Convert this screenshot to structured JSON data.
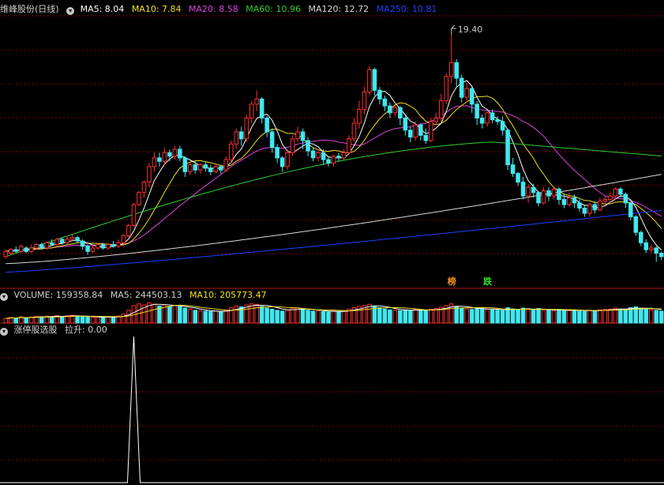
{
  "header": {
    "title": "维峰股份(日线)",
    "ma": [
      {
        "label": "MA5: 8.04",
        "color": "#ffffff"
      },
      {
        "label": "MA10: 7.84",
        "color": "#f0e020"
      },
      {
        "label": "MA20: 8.58",
        "color": "#e040e0"
      },
      {
        "label": "MA60: 10.96",
        "color": "#30d030"
      },
      {
        "label": "MA120: 12.72",
        "color": "#d8d8d8"
      },
      {
        "label": "MA250: 10.81",
        "color": "#2040ff"
      }
    ]
  },
  "volume_header": {
    "volume_label": "VOLUME: 159358.84",
    "ma5_label": "MA5: 244503.13",
    "ma10_label": "MA10: 205773.47"
  },
  "indicator_header": {
    "name": "涨停股选股",
    "value_label": "拉升: 0.00"
  },
  "annotations": {
    "peak_price": "19.40",
    "tag1": "榜",
    "tag2": "跌"
  },
  "colors": {
    "up": "#ff3030",
    "down": "#40e8f0",
    "grid": "#8b0000",
    "ma5": "#ffffff",
    "ma10": "#f0e020",
    "ma20": "#e040e0",
    "ma60": "#30d030",
    "ma120": "#d8d8d8",
    "ma250": "#2040ff"
  },
  "chart_data": {
    "type": "candlestick",
    "price_range": [
      5.0,
      20.5
    ],
    "candles": [
      [
        6.6,
        6.9,
        6.5,
        7.0
      ],
      [
        6.8,
        7.0,
        6.7,
        7.1
      ],
      [
        7.0,
        6.9,
        6.8,
        7.2
      ],
      [
        6.9,
        7.2,
        6.8,
        7.3
      ],
      [
        7.1,
        6.9,
        6.8,
        7.2
      ],
      [
        6.9,
        7.1,
        6.8,
        7.3
      ],
      [
        7.1,
        7.3,
        7.0,
        7.4
      ],
      [
        7.3,
        7.1,
        7.0,
        7.4
      ],
      [
        7.1,
        7.4,
        7.0,
        7.5
      ],
      [
        7.4,
        7.3,
        7.2,
        7.6
      ],
      [
        7.3,
        7.6,
        7.2,
        7.7
      ],
      [
        7.6,
        7.4,
        7.3,
        7.7
      ],
      [
        7.4,
        7.6,
        7.3,
        7.8
      ],
      [
        7.6,
        7.7,
        7.5,
        7.9
      ],
      [
        7.7,
        7.5,
        7.4,
        7.8
      ],
      [
        7.5,
        7.2,
        7.0,
        7.6
      ],
      [
        7.2,
        6.9,
        6.7,
        7.3
      ],
      [
        6.9,
        7.1,
        6.8,
        7.3
      ],
      [
        7.1,
        7.3,
        7.0,
        7.4
      ],
      [
        7.3,
        7.1,
        7.0,
        7.4
      ],
      [
        7.1,
        7.3,
        7.0,
        7.4
      ],
      [
        7.3,
        7.2,
        7.1,
        7.5
      ],
      [
        7.2,
        7.4,
        7.1,
        7.6
      ],
      [
        7.4,
        7.8,
        7.3,
        7.9
      ],
      [
        7.8,
        8.4,
        7.7,
        8.5
      ],
      [
        8.4,
        9.6,
        8.3,
        9.7
      ],
      [
        9.6,
        10.3,
        9.5,
        10.4
      ],
      [
        10.3,
        10.9,
        10.0,
        11.0
      ],
      [
        10.9,
        11.8,
        10.6,
        12.0
      ],
      [
        11.8,
        12.3,
        11.5,
        12.6
      ],
      [
        12.3,
        12.1,
        11.8,
        12.6
      ],
      [
        12.1,
        12.6,
        11.9,
        12.9
      ],
      [
        12.6,
        12.4,
        12.1,
        12.8
      ],
      [
        12.4,
        12.8,
        12.2,
        13.0
      ],
      [
        12.8,
        12.3,
        12.1,
        13.0
      ],
      [
        12.3,
        11.5,
        11.2,
        12.4
      ],
      [
        11.5,
        11.9,
        11.3,
        12.1
      ],
      [
        11.9,
        11.6,
        11.4,
        12.1
      ],
      [
        11.6,
        11.9,
        11.4,
        12.0
      ],
      [
        11.9,
        11.7,
        11.5,
        12.1
      ],
      [
        11.7,
        11.5,
        11.3,
        11.9
      ],
      [
        11.5,
        11.8,
        11.4,
        12.0
      ],
      [
        11.8,
        11.6,
        11.4,
        11.9
      ],
      [
        11.6,
        12.2,
        11.5,
        12.4
      ],
      [
        12.2,
        13.1,
        12.0,
        13.3
      ],
      [
        13.1,
        13.8,
        12.8,
        14.0
      ],
      [
        13.8,
        13.4,
        13.0,
        14.1
      ],
      [
        13.4,
        14.6,
        13.2,
        14.8
      ],
      [
        14.6,
        15.4,
        14.3,
        15.6
      ],
      [
        15.4,
        15.7,
        15.0,
        16.2
      ],
      [
        15.7,
        14.6,
        14.3,
        15.8
      ],
      [
        14.6,
        13.8,
        13.5,
        14.7
      ],
      [
        13.8,
        12.9,
        12.6,
        14.0
      ],
      [
        12.9,
        12.3,
        12.0,
        13.1
      ],
      [
        12.3,
        11.8,
        11.5,
        12.4
      ],
      [
        11.8,
        12.6,
        11.6,
        12.8
      ],
      [
        12.6,
        13.4,
        12.4,
        13.6
      ],
      [
        13.4,
        13.8,
        13.2,
        14.1
      ],
      [
        13.8,
        13.3,
        12.8,
        14.0
      ],
      [
        13.3,
        12.7,
        12.4,
        13.5
      ],
      [
        12.7,
        12.3,
        12.1,
        12.9
      ],
      [
        12.3,
        12.6,
        12.1,
        12.8
      ],
      [
        12.6,
        12.2,
        11.9,
        12.8
      ],
      [
        12.2,
        12.0,
        11.8,
        12.4
      ],
      [
        12.0,
        12.4,
        11.8,
        12.5
      ],
      [
        12.4,
        12.3,
        12.1,
        12.6
      ],
      [
        12.3,
        12.6,
        12.2,
        12.8
      ],
      [
        12.6,
        13.4,
        12.5,
        13.6
      ],
      [
        13.4,
        14.3,
        13.2,
        14.6
      ],
      [
        14.3,
        15.1,
        14.0,
        15.6
      ],
      [
        15.1,
        16.1,
        14.8,
        16.4
      ],
      [
        16.1,
        17.4,
        15.9,
        17.6
      ],
      [
        17.4,
        16.2,
        15.9,
        17.5
      ],
      [
        16.2,
        15.7,
        15.4,
        16.4
      ],
      [
        15.7,
        15.3,
        15.0,
        15.9
      ],
      [
        15.3,
        14.9,
        14.6,
        15.5
      ],
      [
        14.9,
        15.2,
        14.7,
        15.4
      ],
      [
        15.2,
        14.6,
        14.2,
        15.3
      ],
      [
        14.6,
        13.9,
        13.6,
        14.8
      ],
      [
        13.9,
        13.5,
        13.2,
        14.1
      ],
      [
        13.5,
        14.2,
        13.3,
        14.4
      ],
      [
        14.2,
        13.6,
        13.3,
        14.3
      ],
      [
        13.6,
        13.3,
        13.1,
        14.0
      ],
      [
        13.3,
        14.4,
        13.2,
        14.6
      ],
      [
        14.4,
        14.6,
        14.2,
        14.9
      ],
      [
        14.6,
        15.6,
        14.4,
        16.0
      ],
      [
        15.6,
        17.0,
        15.4,
        17.2
      ],
      [
        17.0,
        17.8,
        16.6,
        19.4
      ],
      [
        17.8,
        16.9,
        16.4,
        18.0
      ],
      [
        16.9,
        15.8,
        15.5,
        17.1
      ],
      [
        15.8,
        16.3,
        15.5,
        16.6
      ],
      [
        16.3,
        15.4,
        14.9,
        16.4
      ],
      [
        15.4,
        14.6,
        14.2,
        15.6
      ],
      [
        14.6,
        14.3,
        14.0,
        14.8
      ],
      [
        14.3,
        14.9,
        14.1,
        15.0
      ],
      [
        14.9,
        14.5,
        14.3,
        15.1
      ],
      [
        14.5,
        14.4,
        14.2,
        14.7
      ],
      [
        14.4,
        13.9,
        13.6,
        14.7
      ],
      [
        13.9,
        11.9,
        11.6,
        14.0
      ],
      [
        11.9,
        11.4,
        11.2,
        12.3
      ],
      [
        11.4,
        10.9,
        10.7,
        11.5
      ],
      [
        10.9,
        10.1,
        9.9,
        11.2
      ],
      [
        10.1,
        10.6,
        9.7,
        10.8
      ],
      [
        10.6,
        10.3,
        10.0,
        10.8
      ],
      [
        10.3,
        9.7,
        9.5,
        10.4
      ],
      [
        9.7,
        10.4,
        9.6,
        10.6
      ],
      [
        10.4,
        10.1,
        9.8,
        10.6
      ],
      [
        10.1,
        10.5,
        9.9,
        10.6
      ],
      [
        10.5,
        9.9,
        9.6,
        10.6
      ],
      [
        9.9,
        9.6,
        9.4,
        10.2
      ],
      [
        9.6,
        10.0,
        9.5,
        10.3
      ],
      [
        10.0,
        9.7,
        9.4,
        10.2
      ],
      [
        9.7,
        9.4,
        9.2,
        9.9
      ],
      [
        9.4,
        9.1,
        8.9,
        9.6
      ],
      [
        9.1,
        9.6,
        8.9,
        9.7
      ],
      [
        9.6,
        9.3,
        9.1,
        9.8
      ],
      [
        9.3,
        9.8,
        9.2,
        10.0
      ],
      [
        9.8,
        9.9,
        9.6,
        10.1
      ],
      [
        9.9,
        10.1,
        9.7,
        10.3
      ],
      [
        10.1,
        10.5,
        9.9,
        10.6
      ],
      [
        10.5,
        10.2,
        10.0,
        10.6
      ],
      [
        10.2,
        9.7,
        9.4,
        10.3
      ],
      [
        9.7,
        8.9,
        8.7,
        9.8
      ],
      [
        8.9,
        8.0,
        7.8,
        9.0
      ],
      [
        8.0,
        7.4,
        7.2,
        8.1
      ],
      [
        7.4,
        7.0,
        6.8,
        7.6
      ],
      [
        7.0,
        7.1,
        6.8,
        7.3
      ],
      [
        7.1,
        6.8,
        6.3,
        7.2
      ],
      [
        6.8,
        6.6,
        6.4,
        6.9
      ]
    ],
    "volume_range": [
      0,
      1000000
    ],
    "volumes": [
      220000,
      260000,
      240000,
      300000,
      250000,
      280000,
      320000,
      290000,
      330000,
      300000,
      350000,
      310000,
      340000,
      370000,
      330000,
      300000,
      280000,
      260000,
      290000,
      270000,
      300000,
      280000,
      330000,
      420000,
      600000,
      820000,
      900000,
      850000,
      950000,
      880000,
      800000,
      850000,
      780000,
      820000,
      760000,
      700000,
      650000,
      600000,
      580000,
      560000,
      540000,
      560000,
      520000,
      600000,
      720000,
      800000,
      760000,
      850000,
      900000,
      880000,
      780000,
      700000,
      650000,
      600000,
      560000,
      620000,
      700000,
      720000,
      660000,
      600000,
      560000,
      580000,
      540000,
      520000,
      560000,
      540000,
      580000,
      650000,
      720000,
      780000,
      820000,
      880000,
      800000,
      720000,
      660000,
      620000,
      600000,
      580000,
      620000,
      600000,
      640000,
      600000,
      580000,
      650000,
      680000,
      740000,
      820000,
      900000,
      780000,
      700000,
      660000,
      640000,
      700000,
      680000,
      640000,
      620000,
      600000,
      580000,
      720000,
      660000,
      620000,
      700000,
      650000,
      620000,
      680000,
      600000,
      620000,
      580000,
      640000,
      600000,
      580000,
      620000,
      560000,
      540000,
      600000,
      580000,
      620000,
      640000,
      660000,
      700000,
      660000,
      640000,
      720000,
      760000,
      700000,
      660000,
      620000,
      600000,
      560000
    ],
    "indicator_range": [
      0,
      1.0
    ],
    "indicator_spike_index": 25,
    "indicator_spike_value": 1.0
  }
}
